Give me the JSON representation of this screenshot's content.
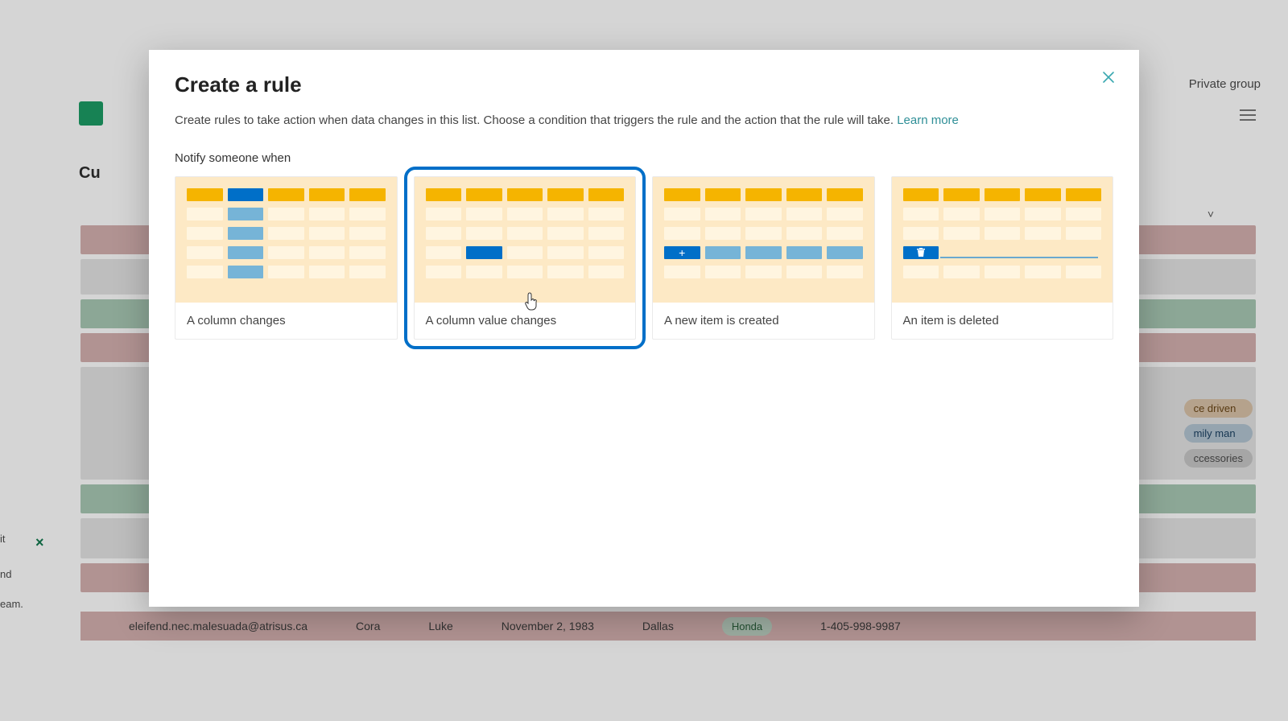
{
  "background": {
    "private_group": "Private group",
    "list_short": "Cu",
    "sidebar_fragment_1": "it",
    "sidebar_fragment_2": "nd",
    "sidebar_fragment_3": "eam.",
    "chevron": "˅",
    "row": {
      "email": "eleifend.nec.malesuada@atrisus.ca",
      "first": "Cora",
      "last": "Luke",
      "date": "November 2, 1983",
      "city": "Dallas",
      "car": "Honda",
      "phone": "1-405-998-9987"
    },
    "badges": [
      "ce driven",
      "mily man",
      "ccessories"
    ]
  },
  "dialog": {
    "title": "Create a rule",
    "description": "Create rules to take action when data changes in this list. Choose a condition that triggers the rule and the action that the rule will take. ",
    "learn_more": "Learn more",
    "section_label": "Notify someone when",
    "selected_index": 1,
    "cards": [
      {
        "label": "A column changes"
      },
      {
        "label": "A column value changes"
      },
      {
        "label": "A new item is created"
      },
      {
        "label": "An item is deleted"
      }
    ]
  }
}
